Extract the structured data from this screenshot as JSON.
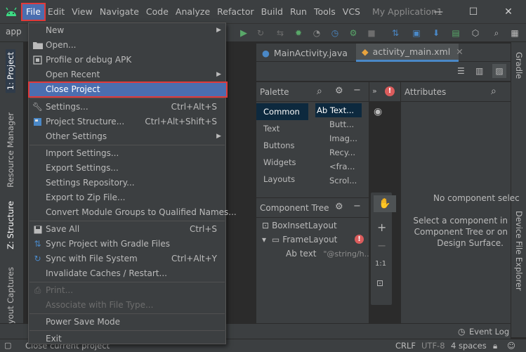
{
  "menubar": {
    "items": [
      "File",
      "Edit",
      "View",
      "Navigate",
      "Code",
      "Analyze",
      "Refactor",
      "Build",
      "Run",
      "Tools",
      "VCS"
    ],
    "window_title": "My Application1",
    "controls": [
      "—",
      "☐",
      "✕"
    ]
  },
  "toolbar": {
    "breadcrumb": "app"
  },
  "left_tools": {
    "project": "1: Project",
    "resource_manager": "Resource Manager",
    "structure": "Z: Structure",
    "layout_captures": "ayout Captures"
  },
  "right_tools": {
    "gradle": "Gradle",
    "device_explorer": "Device File Explorer"
  },
  "editor": {
    "tabs": [
      "MainActivity.java",
      "activity_main.xml"
    ]
  },
  "palette": {
    "title": "Palette",
    "categories": [
      "Common",
      "Text",
      "Buttons",
      "Widgets",
      "Layouts"
    ],
    "items": [
      "Ab Text...",
      "Butt...",
      "Imag...",
      "Recy...",
      "<fra...",
      "Scrol..."
    ]
  },
  "component_tree": {
    "title": "Component Tree",
    "rows": [
      "BoxInsetLayout",
      "FrameLayout",
      "text",
      "\"@string/h..."
    ]
  },
  "zoom": {
    "plus": "+",
    "minus": "−",
    "one_to_one": "1:1"
  },
  "attributes": {
    "title": "Attributes",
    "empty_title": "No component selec",
    "hint_line1": "Select a component in",
    "hint_line2": "Component Tree or on",
    "hint_line3": "Design Surface."
  },
  "status": {
    "message": "Close current project",
    "event_log": "Event Log",
    "line_sep": "CRLF",
    "encoding": "UTF-8",
    "indent": "4 spaces"
  },
  "file_menu": {
    "items": [
      {
        "label": "New",
        "shortcut": "",
        "submenu": true,
        "icon": ""
      },
      {
        "label": "Open...",
        "shortcut": "",
        "submenu": false,
        "icon": "folder-icon"
      },
      {
        "label": "Profile or debug APK",
        "shortcut": "",
        "submenu": false,
        "icon": "apk-icon"
      },
      {
        "label": "Open Recent",
        "shortcut": "",
        "submenu": true,
        "icon": ""
      },
      {
        "label": "Close Project",
        "shortcut": "",
        "submenu": false,
        "icon": ""
      },
      {
        "label": "Settings...",
        "shortcut": "Ctrl+Alt+S",
        "submenu": false,
        "icon": "wrench-icon"
      },
      {
        "label": "Project Structure...",
        "shortcut": "Ctrl+Alt+Shift+S",
        "submenu": false,
        "icon": "structure-icon"
      },
      {
        "label": "Other Settings",
        "shortcut": "",
        "submenu": true,
        "icon": ""
      },
      {
        "label": "Import Settings...",
        "shortcut": "",
        "submenu": false,
        "icon": ""
      },
      {
        "label": "Export Settings...",
        "shortcut": "",
        "submenu": false,
        "icon": ""
      },
      {
        "label": "Settings Repository...",
        "shortcut": "",
        "submenu": false,
        "icon": ""
      },
      {
        "label": "Export to Zip File...",
        "shortcut": "",
        "submenu": false,
        "icon": ""
      },
      {
        "label": "Convert Module Groups to Qualified Names...",
        "shortcut": "",
        "submenu": false,
        "icon": ""
      },
      {
        "label": "Save All",
        "shortcut": "Ctrl+S",
        "submenu": false,
        "icon": "save-icon"
      },
      {
        "label": "Sync Project with Gradle Files",
        "shortcut": "",
        "submenu": false,
        "icon": "gradle-sync-icon"
      },
      {
        "label": "Sync with File System",
        "shortcut": "Ctrl+Alt+Y",
        "submenu": false,
        "icon": "refresh-icon"
      },
      {
        "label": "Invalidate Caches / Restart...",
        "shortcut": "",
        "submenu": false,
        "icon": ""
      },
      {
        "label": "Print...",
        "shortcut": "",
        "submenu": false,
        "icon": "print-icon",
        "disabled": true
      },
      {
        "label": "Associate with File Type...",
        "shortcut": "",
        "submenu": false,
        "icon": "",
        "disabled": true
      },
      {
        "label": "Power Save Mode",
        "shortcut": "",
        "submenu": false,
        "icon": ""
      },
      {
        "label": "Exit",
        "shortcut": "",
        "submenu": false,
        "icon": ""
      }
    ]
  },
  "colors": {
    "accent": "#4b6eaf",
    "highlight_outline": "#e03a3a",
    "bg_dark": "#2b2b2b",
    "bg_panel": "#3c3f41",
    "run_green": "#59a869",
    "error_red": "#db5c5c"
  }
}
